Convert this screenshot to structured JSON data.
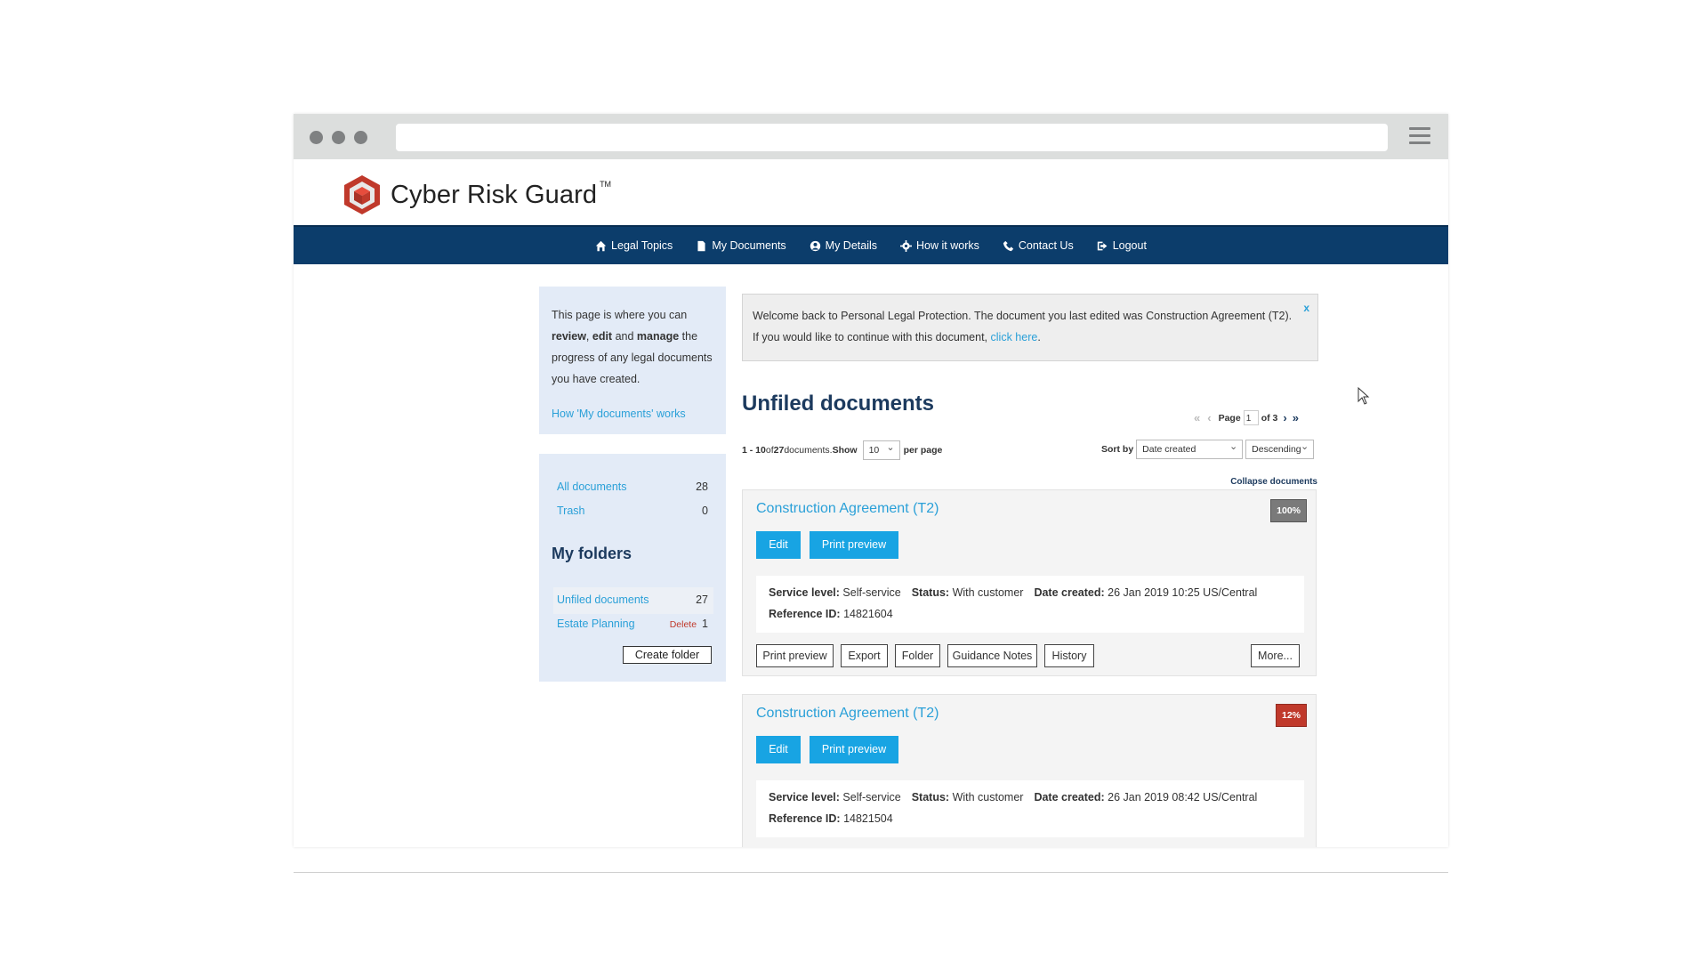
{
  "brand": {
    "name": "Cyber Risk Guard",
    "tm": "TM"
  },
  "colors": {
    "nav": "#0c3d6b",
    "accent": "#18a4e3",
    "link": "#2aa0d8",
    "badge_complete": "#7a7a7a",
    "badge_low": "#c0392b"
  },
  "nav": [
    {
      "label": "Legal Topics",
      "icon": "home-icon"
    },
    {
      "label": "My Documents",
      "icon": "document-icon"
    },
    {
      "label": "My Details",
      "icon": "user-icon"
    },
    {
      "label": "How it works",
      "icon": "gear-icon"
    },
    {
      "label": "Contact Us",
      "icon": "phone-icon"
    },
    {
      "label": "Logout",
      "icon": "logout-icon"
    }
  ],
  "sidebar": {
    "info": {
      "t1": "This page is where you can ",
      "review": "review",
      "comma": ", ",
      "edit": "edit",
      "and": " and ",
      "manage": "manage",
      "t2": " the progress of any legal documents you have created."
    },
    "how_link": "How 'My documents' works",
    "all": {
      "label": "All documents",
      "count": "28"
    },
    "trash": {
      "label": "Trash",
      "count": "0"
    },
    "folders_title": "My folders",
    "unfiled": {
      "label": "Unfiled documents",
      "count": "27"
    },
    "estate": {
      "label": "Estate Planning",
      "delete": "Delete",
      "count": "1"
    },
    "create_folder": "Create folder"
  },
  "alert": {
    "text": "Welcome back to Personal Legal Protection. The document you last edited was Construction Agreement (T2). If you would like to continue with this document, ",
    "link": "click here",
    "period": ".",
    "close": "x"
  },
  "main": {
    "title": "Unfiled documents",
    "pager": {
      "prefix": "Page",
      "value": "1",
      "suffix": "of 3"
    },
    "range": "1 - 10",
    "of": " of ",
    "total": "27",
    "docs_word": " documents. ",
    "show": "Show",
    "per_page_value": "10",
    "per_page": "per page",
    "sort_by": "Sort by",
    "sort_value": "Date created",
    "order_value": "Descending",
    "collapse": "Collapse documents"
  },
  "documents": [
    {
      "title": "Construction Agreement (T2)",
      "progress": "100%",
      "edit": "Edit",
      "print": "Print preview",
      "service_label": "Service level:",
      "service": "Self-service",
      "status_label": "Status:",
      "status": "With customer",
      "created_label": "Date created:",
      "created": "26 Jan 2019 10:25 US/Central",
      "ref_label": "Reference ID:",
      "ref": "14821604",
      "actions": [
        "Print preview",
        "Export",
        "Folder",
        "Guidance Notes",
        "History"
      ],
      "more": "More..."
    },
    {
      "title": "Construction Agreement (T2)",
      "progress": "12%",
      "edit": "Edit",
      "print": "Print preview",
      "service_label": "Service level:",
      "service": "Self-service",
      "status_label": "Status:",
      "status": "With customer",
      "created_label": "Date created:",
      "created": "26 Jan 2019 08:42 US/Central",
      "ref_label": "Reference ID:",
      "ref": "14821504"
    }
  ]
}
